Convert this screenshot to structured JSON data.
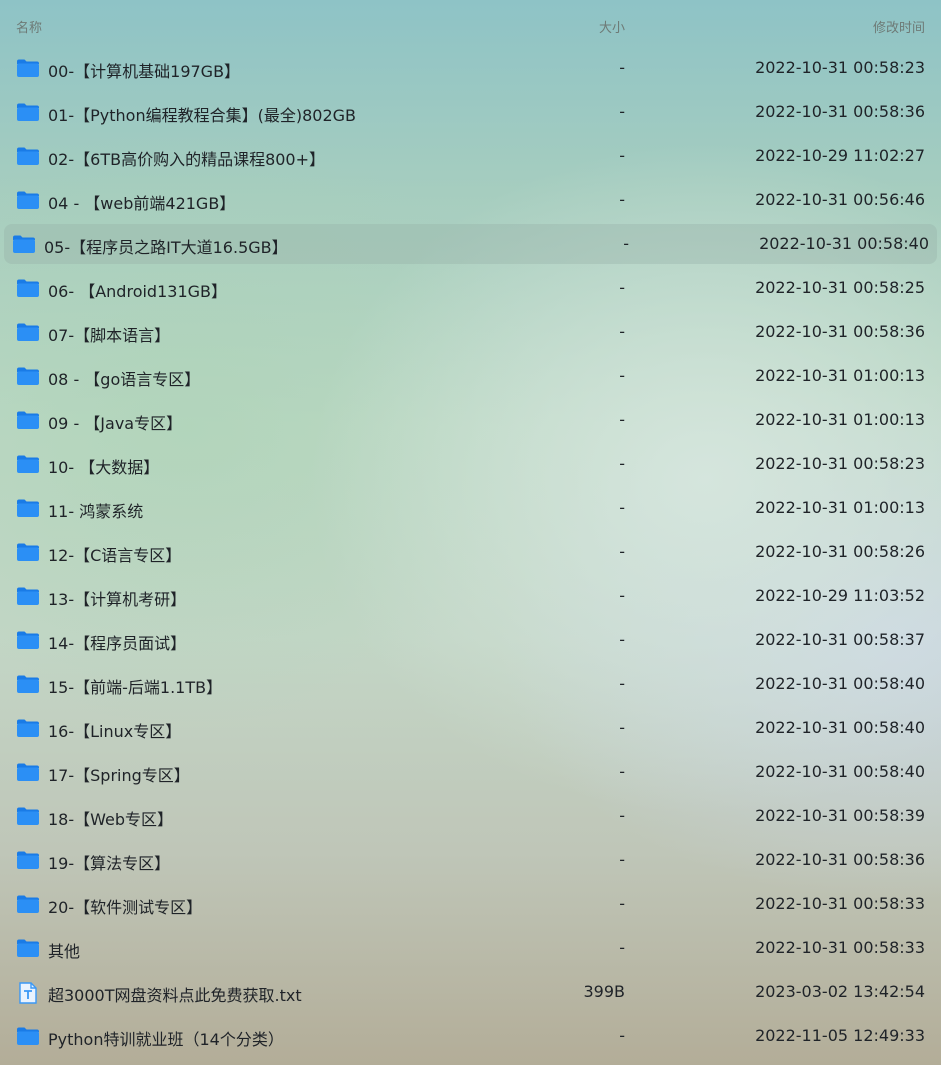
{
  "header": {
    "name": "名称",
    "size": "大小",
    "modified": "修改时间"
  },
  "rows": [
    {
      "name": "00-【计算机基础197GB】",
      "size": "-",
      "time": "2022-10-31 00:58:23",
      "type": "folder"
    },
    {
      "name": "01-【Python编程教程合集】(最全)802GB",
      "size": "-",
      "time": "2022-10-31 00:58:36",
      "type": "folder"
    },
    {
      "name": "02-【6TB高价购入的精品课程800+】",
      "size": "-",
      "time": "2022-10-29 11:02:27",
      "type": "folder"
    },
    {
      "name": "04 - 【web前端421GB】",
      "size": "-",
      "time": "2022-10-31 00:56:46",
      "type": "folder"
    },
    {
      "name": "05-【程序员之路IT大道16.5GB】",
      "size": "-",
      "time": "2022-10-31 00:58:40",
      "type": "folder",
      "selected": true
    },
    {
      "name": "06- 【Android131GB】",
      "size": "-",
      "time": "2022-10-31 00:58:25",
      "type": "folder"
    },
    {
      "name": "07-【脚本语言】",
      "size": "-",
      "time": "2022-10-31 00:58:36",
      "type": "folder"
    },
    {
      "name": "08 - 【go语言专区】",
      "size": "-",
      "time": "2022-10-31 01:00:13",
      "type": "folder"
    },
    {
      "name": "09 - 【Java专区】",
      "size": "-",
      "time": "2022-10-31 01:00:13",
      "type": "folder"
    },
    {
      "name": "10- 【大数据】",
      "size": "-",
      "time": "2022-10-31 00:58:23",
      "type": "folder"
    },
    {
      "name": "11- 鸿蒙系统",
      "size": "-",
      "time": "2022-10-31 01:00:13",
      "type": "folder"
    },
    {
      "name": "12-【C语言专区】",
      "size": "-",
      "time": "2022-10-31 00:58:26",
      "type": "folder"
    },
    {
      "name": "13-【计算机考研】",
      "size": "-",
      "time": "2022-10-29 11:03:52",
      "type": "folder"
    },
    {
      "name": "14-【程序员面试】",
      "size": "-",
      "time": "2022-10-31 00:58:37",
      "type": "folder"
    },
    {
      "name": "15-【前端-后端1.1TB】",
      "size": "-",
      "time": "2022-10-31 00:58:40",
      "type": "folder"
    },
    {
      "name": "16-【Linux专区】",
      "size": "-",
      "time": "2022-10-31 00:58:40",
      "type": "folder"
    },
    {
      "name": "17-【Spring专区】",
      "size": "-",
      "time": "2022-10-31 00:58:40",
      "type": "folder"
    },
    {
      "name": "18-【Web专区】",
      "size": "-",
      "time": "2022-10-31 00:58:39",
      "type": "folder"
    },
    {
      "name": "19-【算法专区】",
      "size": "-",
      "time": "2022-10-31 00:58:36",
      "type": "folder"
    },
    {
      "name": "20-【软件测试专区】",
      "size": "-",
      "time": "2022-10-31 00:58:33",
      "type": "folder"
    },
    {
      "name": "其他",
      "size": "-",
      "time": "2022-10-31 00:58:33",
      "type": "folder"
    },
    {
      "name": "超3000T网盘资料点此免费获取.txt",
      "size": "399B",
      "time": "2023-03-02 13:42:54",
      "type": "text-file"
    },
    {
      "name": "Python特训就业班（14个分类）",
      "size": "-",
      "time": "2022-11-05 12:49:33",
      "type": "folder"
    }
  ],
  "colors": {
    "folder": "#2b8ff5",
    "folder_tab": "#1a7be6",
    "text_file": "#3a98f6"
  }
}
